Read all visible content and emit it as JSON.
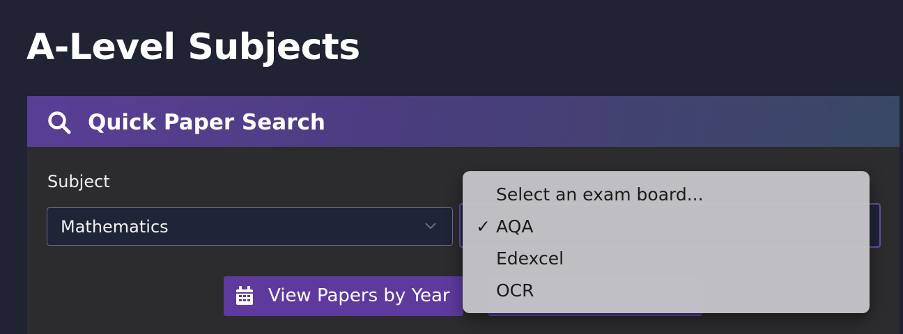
{
  "page": {
    "title": "A-Level Subjects"
  },
  "card": {
    "header_title": "Quick Paper Search",
    "header_icon": "search-icon"
  },
  "subject_field": {
    "label": "Subject",
    "selected_value": "Mathematics"
  },
  "exam_board_field": {
    "options": [
      "Select an exam board...",
      "AQA",
      "Edexcel",
      "OCR"
    ],
    "selected_option": "AQA"
  },
  "actions": {
    "view_papers_label": "View Papers by Year",
    "view_papers_icon": "calendar-icon"
  },
  "colors": {
    "background": "#1f2333",
    "card": "#2c2c2e",
    "header_gradient_start": "#5a3e96",
    "header_gradient_end": "#384863",
    "button_primary": "#5e3a9e",
    "dropdown_bg": "#c4c4c8"
  }
}
